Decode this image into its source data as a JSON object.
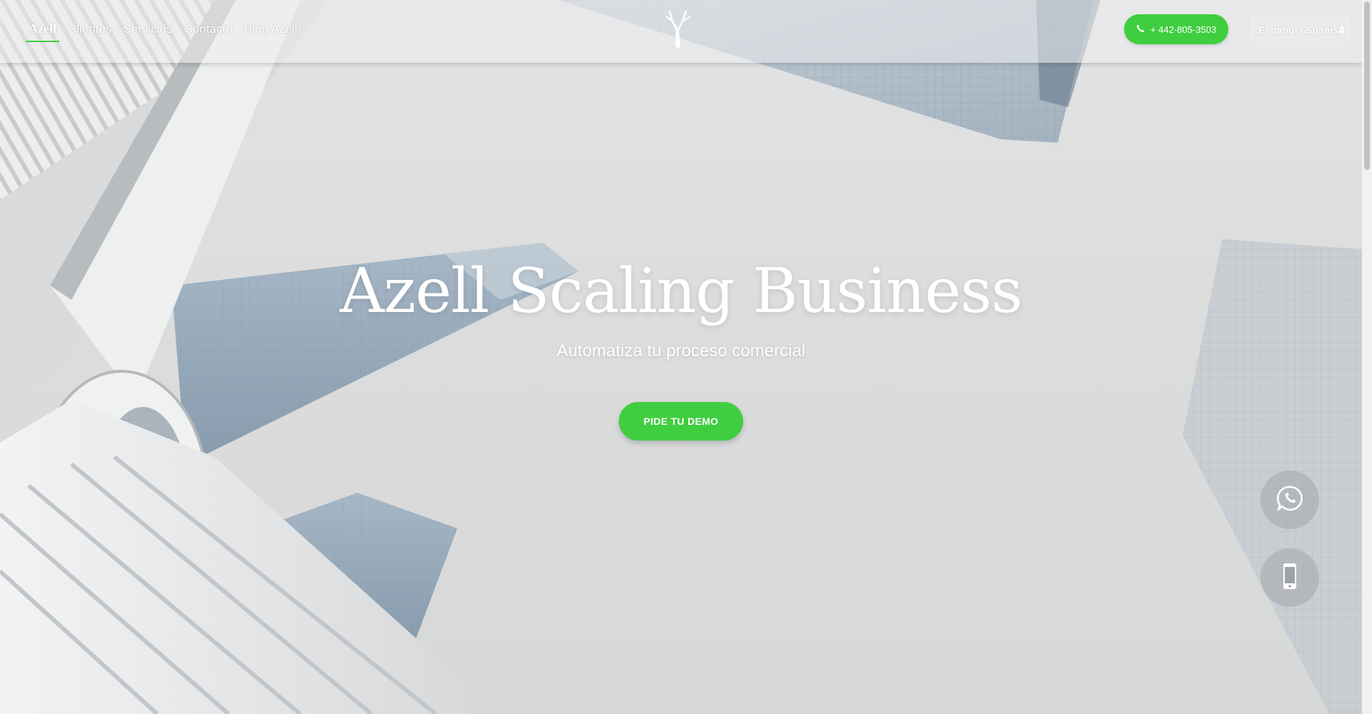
{
  "nav": {
    "items": [
      {
        "label": "Azell",
        "active": true
      },
      {
        "label": "Clientes",
        "active": false
      },
      {
        "label": "Servicios",
        "active": false
      },
      {
        "label": "Contacto",
        "active": false
      },
      {
        "label": "Blog Azell",
        "active": false
      }
    ]
  },
  "header": {
    "logo_icon": "deer-antler-icon",
    "phone_label": "+ 442-805-3503",
    "phone_icon": "phone-icon",
    "language_selected": "Español / Spanish"
  },
  "hero": {
    "title": "Azell Scaling Business",
    "subtitle": "Automatiza tu proceso comercial",
    "cta_label": "PIDE TU DEMO"
  },
  "floating": {
    "whatsapp_icon": "whatsapp-icon",
    "mobile_icon": "mobile-phone-icon"
  },
  "colors": {
    "accent": "#3fce3f",
    "text_light": "#ffffff"
  }
}
